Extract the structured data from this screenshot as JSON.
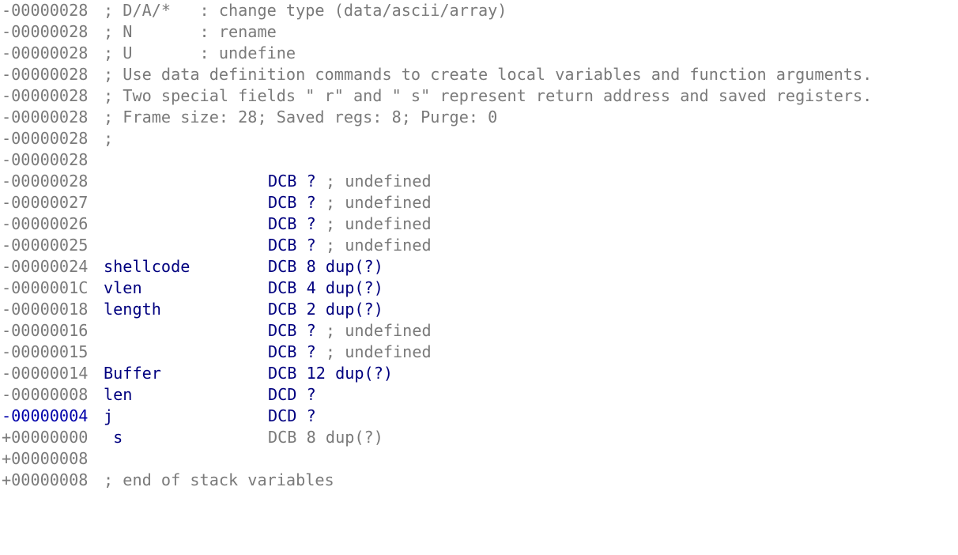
{
  "lines": [
    {
      "addr": "-00000028",
      "comment": "; D/A/*   : change type (data/ascii/array)"
    },
    {
      "addr": "-00000028",
      "comment": "; N       : rename"
    },
    {
      "addr": "-00000028",
      "comment": "; U       : undefine"
    },
    {
      "addr": "-00000028",
      "comment": "; Use data definition commands to create local variables and function arguments."
    },
    {
      "addr": "-00000028",
      "comment": "; Two special fields \" r\" and \" s\" represent return address and saved registers."
    },
    {
      "addr": "-00000028",
      "comment": "; Frame size: 28; Saved regs: 8; Purge: 0"
    },
    {
      "addr": "-00000028",
      "comment": ";"
    },
    {
      "addr": "-00000028"
    },
    {
      "addr": "-00000028",
      "name": "",
      "def": "DCB ?",
      "tail": " ; undefined"
    },
    {
      "addr": "-00000027",
      "name": "",
      "def": "DCB ?",
      "tail": " ; undefined"
    },
    {
      "addr": "-00000026",
      "name": "",
      "def": "DCB ?",
      "tail": " ; undefined"
    },
    {
      "addr": "-00000025",
      "name": "",
      "def": "DCB ?",
      "tail": " ; undefined"
    },
    {
      "addr": "-00000024",
      "name": "shellcode",
      "def": "DCB 8 dup(?)",
      "tail": ""
    },
    {
      "addr": "-0000001C",
      "name": "vlen",
      "def": "DCB 4 dup(?)",
      "tail": ""
    },
    {
      "addr": "-00000018",
      "name": "length",
      "def": "DCB 2 dup(?)",
      "tail": ""
    },
    {
      "addr": "-00000016",
      "name": "",
      "def": "DCB ?",
      "tail": " ; undefined"
    },
    {
      "addr": "-00000015",
      "name": "",
      "def": "DCB ?",
      "tail": " ; undefined"
    },
    {
      "addr": "-00000014",
      "name": "Buffer",
      "def": "DCB 12 dup(?)",
      "tail": ""
    },
    {
      "addr": "-00000008",
      "name": "len",
      "def": "DCD ?",
      "tail": ""
    },
    {
      "addr": "-00000004",
      "name": "j",
      "def": "DCD ?",
      "tail": ""
    },
    {
      "addr": "+00000000",
      "name": " s",
      "def": "DCB 8 dup(?)",
      "tail": ""
    },
    {
      "addr": "+00000008"
    },
    {
      "addr": "+00000008",
      "comment": "; end of stack variables"
    }
  ]
}
